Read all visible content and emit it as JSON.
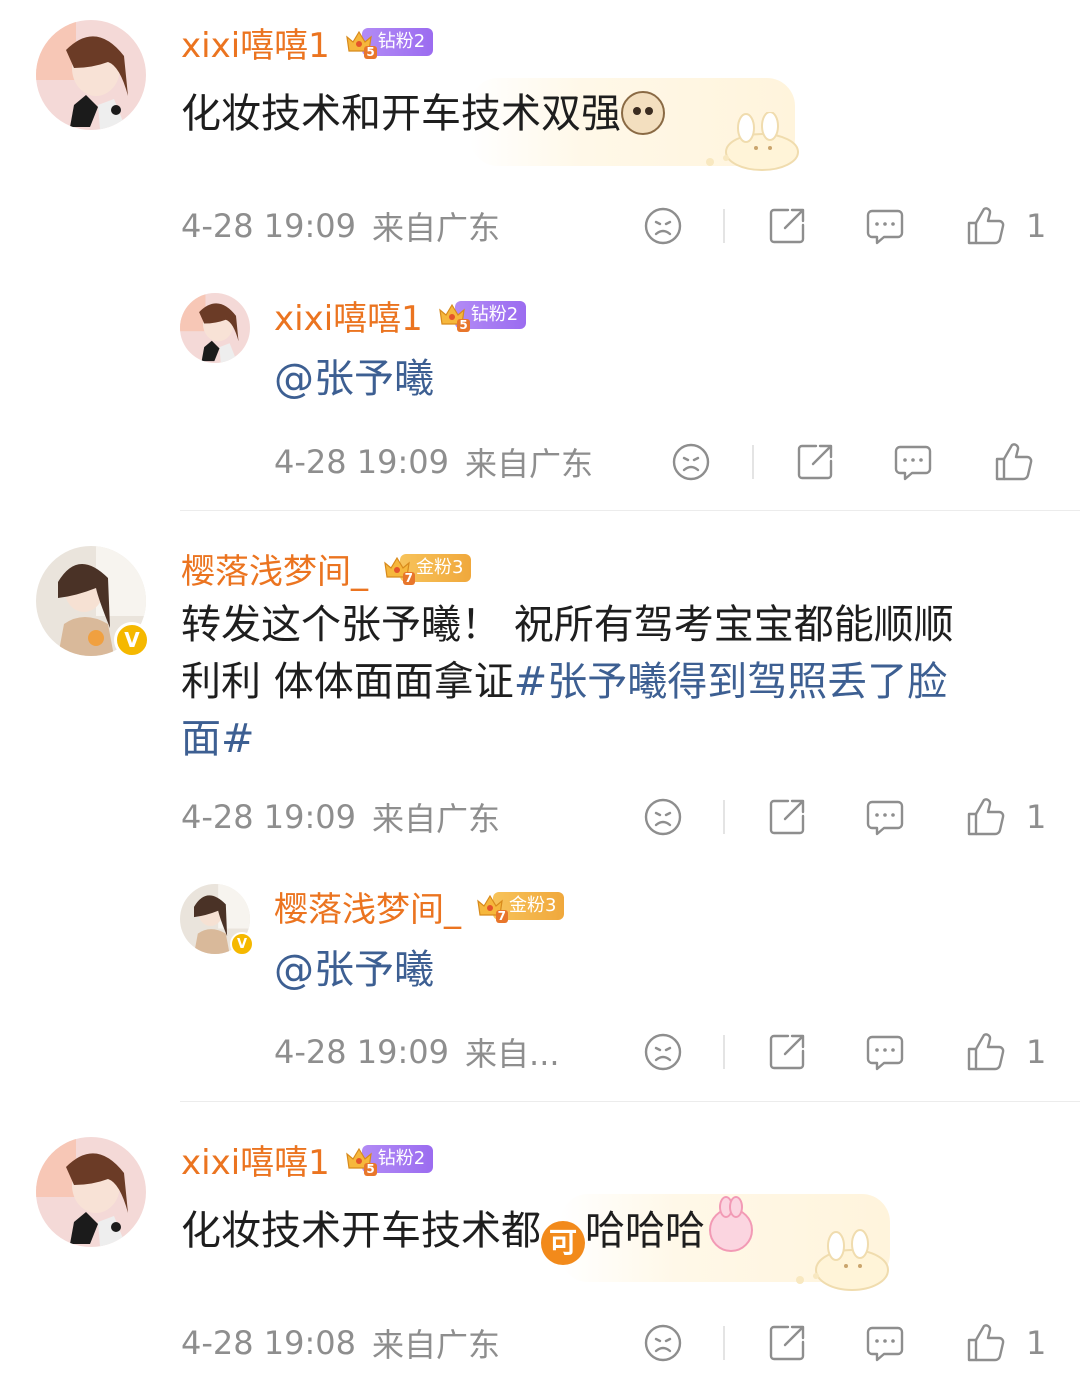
{
  "comments": [
    {
      "username": "xixi嘻嘻1",
      "badge_level": "5",
      "badge_label": "钻粉2",
      "text": "化妆技术和开车技术双强",
      "time": "4-28 19:09",
      "location": "来自广东",
      "likes": "1",
      "reply": {
        "username": "xixi嘻嘻1",
        "badge_level": "5",
        "badge_label": "钻粉2",
        "mention": "@张予曦",
        "time": "4-28 19:09",
        "location": "来自广东",
        "likes": ""
      }
    },
    {
      "username": "樱落浅梦间_",
      "badge_level": "7",
      "badge_label": "金粉3",
      "verified": "V",
      "text_lines": [
        "转发这个张予曦！ 祝所有驾考宝宝都能顺顺",
        "利利 体体面面拿证"
      ],
      "topic_part1": "#张予曦得到驾照丢了脸",
      "topic_part2": "面#",
      "time": "4-28 19:09",
      "location": "来自广东",
      "likes": "1",
      "reply": {
        "username": "樱落浅梦间_",
        "badge_level": "7",
        "badge_label": "金粉3",
        "verified": "V",
        "mention": "@张予曦",
        "time": "4-28 19:09",
        "location": "来自...",
        "likes": "1"
      }
    },
    {
      "username": "xixi嘻嘻1",
      "badge_level": "5",
      "badge_label": "钻粉2",
      "text_a": "化妆技术开车技术都",
      "emoji_ke": "可",
      "text_b": "哈哈哈",
      "time": "4-28 19:08",
      "location": "来自广东",
      "likes": "1"
    }
  ],
  "icons": [
    "frown-icon",
    "share-icon",
    "comment-icon",
    "thumbs-up-icon",
    "crown-icon"
  ],
  "colors": {
    "username": "#eb7420",
    "link": "#3d5f92",
    "meta": "#8e8e8e",
    "badge_purple": "#9b6cf0",
    "badge_gold": "#f0a83c",
    "verified": "#f5b800"
  }
}
